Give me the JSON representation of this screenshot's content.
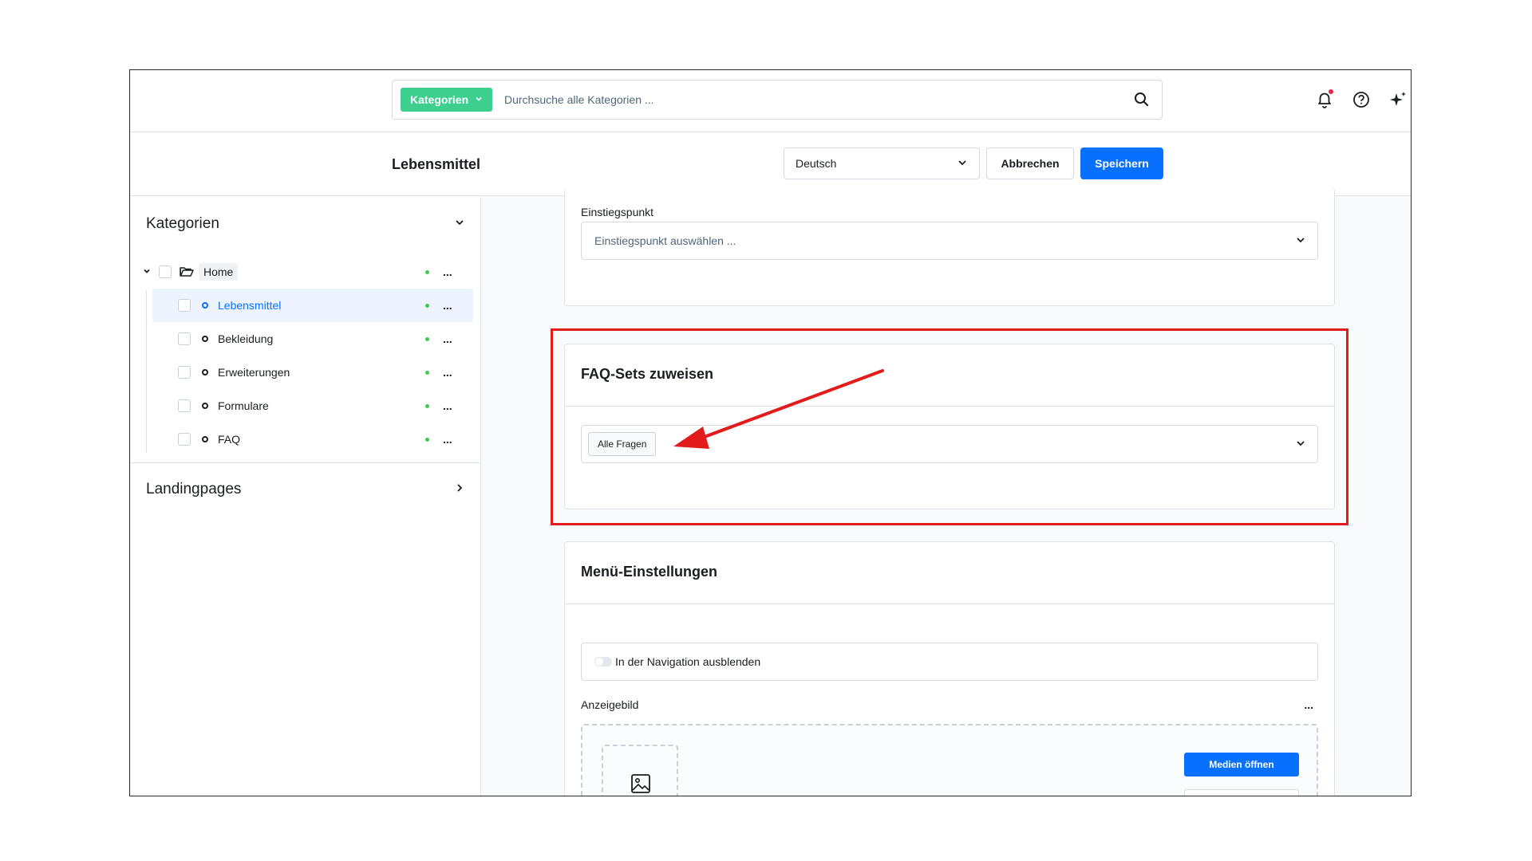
{
  "topbar": {
    "category_pill": "Kategorien",
    "search_placeholder": "Durchsuche alle Kategorien ..."
  },
  "header": {
    "title": "Lebensmittel",
    "language": "Deutsch",
    "cancel_label": "Abbrechen",
    "save_label": "Speichern"
  },
  "sidebar": {
    "section1": "Kategorien",
    "section2": "Landingpages",
    "tree": [
      {
        "label": "Home"
      },
      {
        "label": "Lebensmittel"
      },
      {
        "label": "Bekleidung"
      },
      {
        "label": "Erweiterungen"
      },
      {
        "label": "Formulare"
      },
      {
        "label": "FAQ"
      }
    ],
    "more": "..."
  },
  "main": {
    "entry_label": "Einstiegspunkt",
    "entry_placeholder": "Einstiegspunkt auswählen ...",
    "faq_title": "FAQ-Sets zuweisen",
    "faq_tag": "Alle Fragen",
    "menu_title": "Menü-Einstellungen",
    "toggle_label": "In der Navigation ausblenden",
    "image_label": "Anzeigebild",
    "image_more": "...",
    "media_button": "Medien öffnen"
  },
  "colors": {
    "accent": "#0870ff",
    "category_pill": "#3ccf8e",
    "status_dot": "#37d046",
    "highlight": "#e21b1b"
  }
}
